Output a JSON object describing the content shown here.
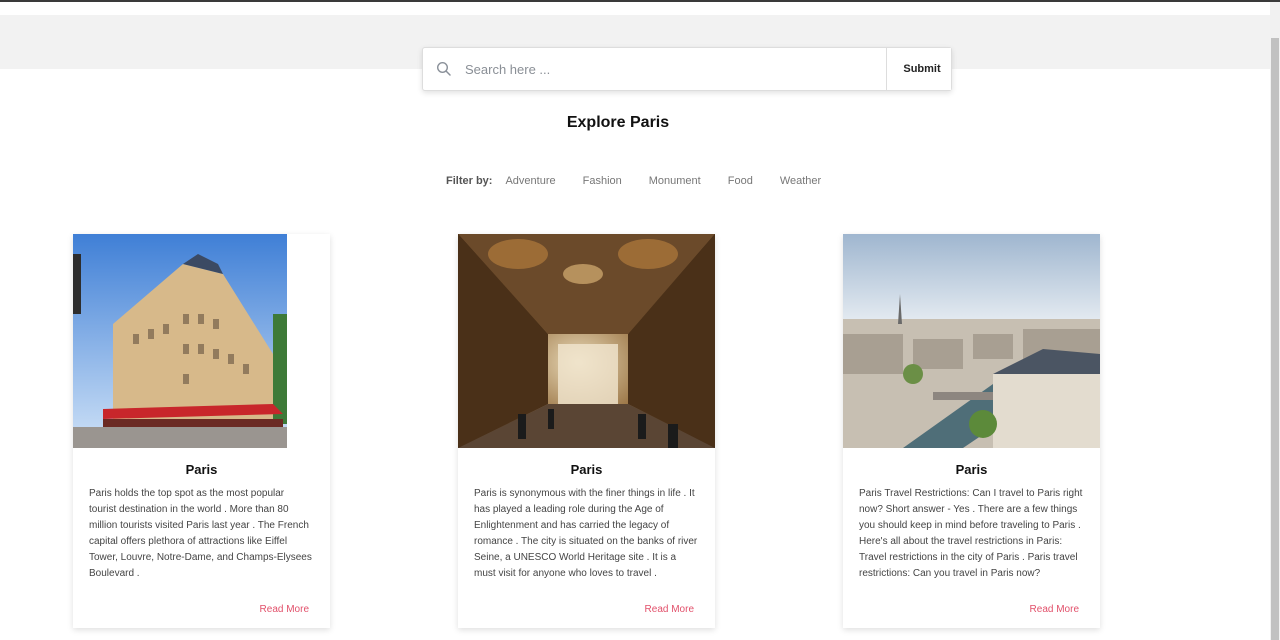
{
  "search": {
    "placeholder": "Search here ...",
    "submit_label": "Submit"
  },
  "page": {
    "title": "Explore Paris"
  },
  "filter": {
    "label": "Filter by:",
    "options": [
      "Adventure",
      "Fashion",
      "Monument",
      "Food",
      "Weather"
    ]
  },
  "cards": [
    {
      "image": "paris-street-building-photo",
      "title": "Paris",
      "text": "Paris holds the top spot as the most popular tourist destination in the world . More than 80 million tourists visited Paris last year . The French capital offers plethora of attractions like Eiffel Tower, Louvre, Notre-Dame, and Champs-Elysees Boulevard .",
      "link": "Read More"
    },
    {
      "image": "palace-gallery-hall-photo",
      "title": "Paris",
      "text": "Paris is synonymous with the finer things in life . It has played a leading role during the Age of Enlightenment and has carried the legacy of romance . The city is situated on the banks of river Seine, a UNESCO World Heritage site . It is a must visit for anyone who loves to travel .",
      "link": "Read More"
    },
    {
      "image": "paris-skyline-eiffel-photo",
      "title": "Paris",
      "text": "Paris Travel Restrictions: Can I travel to Paris right now? Short answer - Yes . There are a few things you should keep in mind before traveling to Paris . Here's all about the travel restrictions in Paris: Travel restrictions in the city of Paris . Paris travel restrictions: Can you travel in Paris now?",
      "link": "Read More"
    }
  ],
  "colors": {
    "accent": "#e2516b",
    "hero_bg": "#f2f2f2"
  }
}
